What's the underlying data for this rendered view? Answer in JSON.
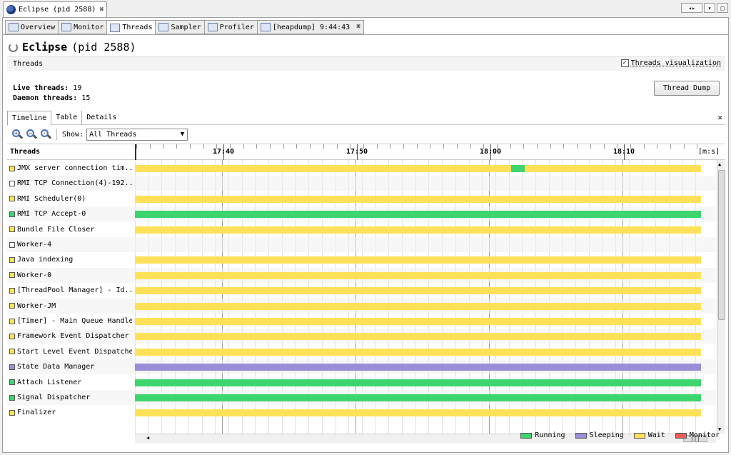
{
  "window": {
    "tab_label": "Eclipse (pid 2588)",
    "tab_close": "⌘"
  },
  "view_tabs": [
    {
      "label": "Overview",
      "active": false
    },
    {
      "label": "Monitor",
      "active": false
    },
    {
      "label": "Threads",
      "active": true
    },
    {
      "label": "Sampler",
      "active": false
    },
    {
      "label": "Profiler",
      "active": false
    },
    {
      "label": "[heapdump] 9:44:43",
      "active": false
    }
  ],
  "app": {
    "name": "Eclipse",
    "pid": "(pid 2588)"
  },
  "threads_section": {
    "title": "Threads",
    "visualization_label": "Threads visualization",
    "visualization_checked": true
  },
  "stats": {
    "live_label": "Live threads:",
    "live_value": "19",
    "daemon_label": "Daemon threads:",
    "daemon_value": "15"
  },
  "thread_dump_button": "Thread Dump",
  "subtabs": [
    "Timeline",
    "Table",
    "Details"
  ],
  "toolbar": {
    "show_label": "Show:",
    "show_value": "All Threads"
  },
  "timeline": {
    "header": "Threads",
    "ticks": [
      "17:40",
      "17:50",
      "18:00",
      "18:10"
    ],
    "unit": "[m:s]"
  },
  "legend": {
    "running": "Running",
    "sleeping": "Sleeping",
    "wait": "Wait",
    "monitor": "Monitor"
  },
  "colors": {
    "running": "#3dd56d",
    "sleeping": "#9b8ed8",
    "wait": "#ffe159",
    "monitor": "#f15a5a",
    "none": "#ffffff"
  },
  "threads": [
    {
      "name": "JMX server connection tim...",
      "state": "wait",
      "segments": [
        [
          "wait",
          0,
          0.664
        ],
        [
          "running",
          0.664,
          0.689
        ],
        [
          "wait",
          0.689,
          1
        ]
      ]
    },
    {
      "name": "RMI TCP Connection(4)-192...",
      "state": "none",
      "segments": []
    },
    {
      "name": "RMI Scheduler(0)",
      "state": "wait",
      "segments": [
        [
          "wait",
          0,
          1
        ]
      ]
    },
    {
      "name": "RMI TCP Accept-0",
      "state": "running",
      "segments": [
        [
          "running",
          0,
          1
        ]
      ]
    },
    {
      "name": "Bundle File Closer",
      "state": "wait",
      "segments": [
        [
          "wait",
          0,
          1
        ]
      ]
    },
    {
      "name": "Worker-4",
      "state": "none",
      "segments": []
    },
    {
      "name": "Java indexing",
      "state": "wait",
      "segments": [
        [
          "wait",
          0,
          1
        ]
      ]
    },
    {
      "name": "Worker-0",
      "state": "wait",
      "segments": [
        [
          "wait",
          0,
          1
        ]
      ]
    },
    {
      "name": "[ThreadPool Manager] - Id...",
      "state": "wait",
      "segments": [
        [
          "wait",
          0,
          1
        ]
      ]
    },
    {
      "name": "Worker-JM",
      "state": "wait",
      "segments": [
        [
          "wait",
          0,
          1
        ]
      ]
    },
    {
      "name": "[Timer] - Main Queue Handler",
      "state": "wait",
      "segments": [
        [
          "wait",
          0,
          1
        ]
      ]
    },
    {
      "name": "Framework Event Dispatcher",
      "state": "wait",
      "segments": [
        [
          "wait",
          0,
          1
        ]
      ]
    },
    {
      "name": "Start Level Event Dispatcher",
      "state": "wait",
      "segments": [
        [
          "wait",
          0,
          1
        ]
      ]
    },
    {
      "name": "State Data Manager",
      "state": "sleeping",
      "segments": [
        [
          "sleeping",
          0,
          1
        ]
      ]
    },
    {
      "name": "Attach Listener",
      "state": "running",
      "segments": [
        [
          "running",
          0,
          1
        ]
      ]
    },
    {
      "name": "Signal Dispatcher",
      "state": "running",
      "segments": [
        [
          "running",
          0,
          1
        ]
      ]
    },
    {
      "name": "Finalizer",
      "state": "wait",
      "segments": [
        [
          "wait",
          0,
          1
        ]
      ]
    }
  ]
}
